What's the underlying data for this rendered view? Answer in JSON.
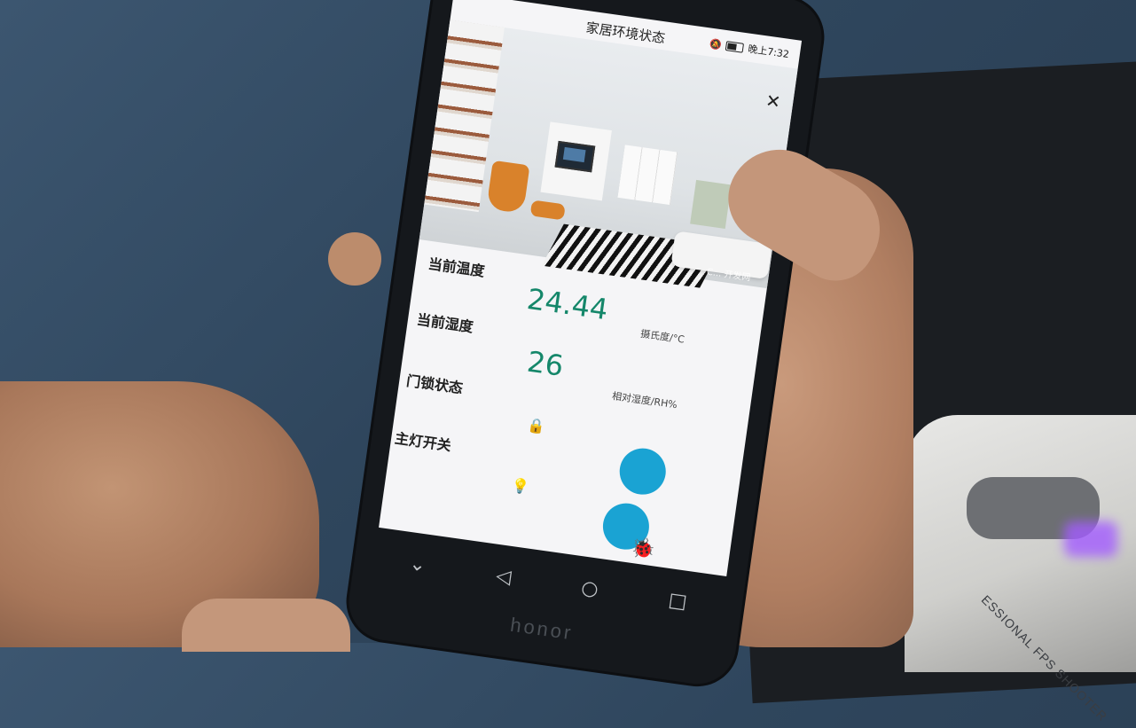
{
  "app": {
    "title": "家居环境状态",
    "status_time": "晚上7:32",
    "close_icon": "close-icon"
  },
  "hero": {
    "watermark": "C... 开发网"
  },
  "temperature": {
    "label": "当前温度",
    "value": "24.44",
    "unit": "摄氏度/°C"
  },
  "humidity": {
    "label": "当前湿度",
    "value": "26",
    "unit": "相对湿度/RH%"
  },
  "door_lock": {
    "label": "门锁状态",
    "icon": "lock-icon"
  },
  "main_light": {
    "label": "主灯开关",
    "icon": "lightbulb-icon"
  },
  "navigation": {
    "back_icon": "back-triangle-icon",
    "home_icon": "home-circle-icon",
    "recents_icon": "recents-square-icon",
    "down_icon": "chevron-down-icon"
  },
  "phone_brand": "honor",
  "mouse_text": "ESSIONAL FPS SHOOTER",
  "colors": {
    "accent_value": "#15876a",
    "button": "#1aa3d3",
    "bug": "#c81e1e"
  }
}
